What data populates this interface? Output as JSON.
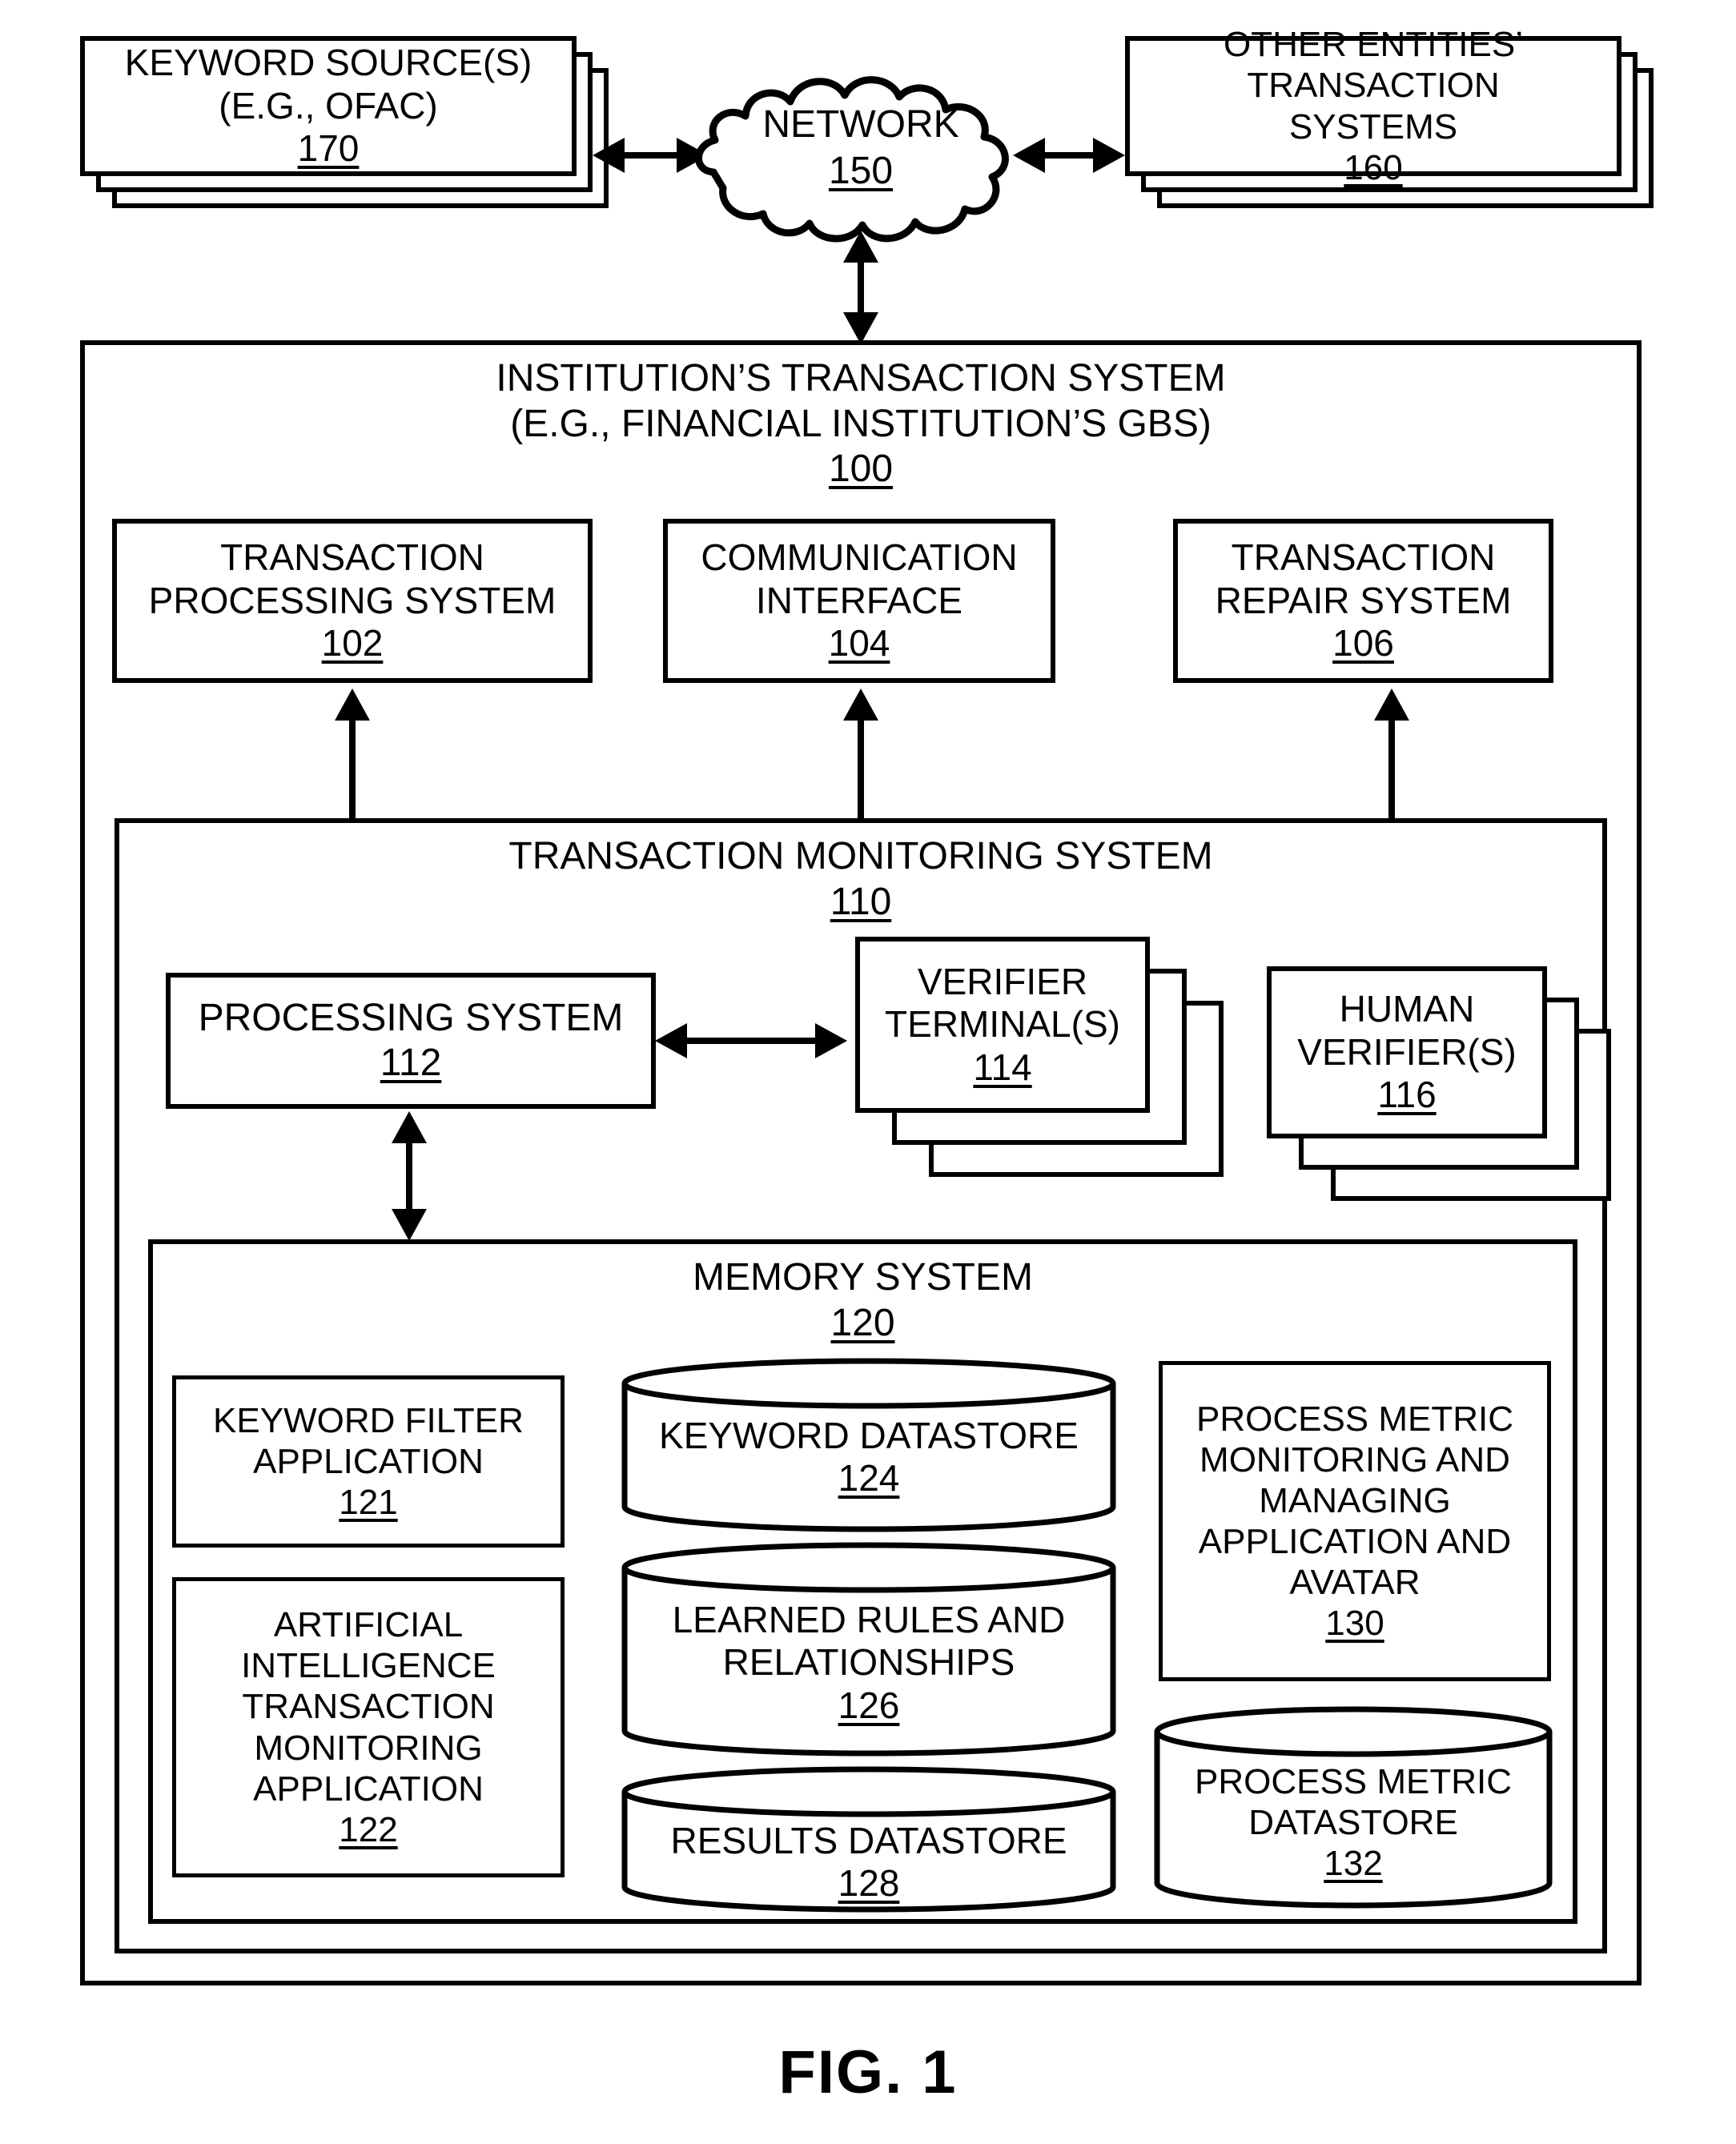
{
  "figure": {
    "caption": "FIG. 1"
  },
  "top_row": {
    "keyword_sources": {
      "line1": "KEYWORD SOURCE(S)",
      "line2": "(E.G., OFAC)",
      "ref": "170"
    },
    "network": {
      "label": "NETWORK",
      "ref": "150"
    },
    "other_entities": {
      "line1": "OTHER ENTITIES’",
      "line2": "TRANSACTION",
      "line3": "SYSTEMS",
      "ref": "160"
    }
  },
  "institution_system": {
    "title_line1": "INSTITUTION’S TRANSACTION SYSTEM",
    "title_line2": "(E.G., FINANCIAL INSTITUTION’S GBS)",
    "ref": "100",
    "components": [
      {
        "line1": "TRANSACTION",
        "line2": "PROCESSING SYSTEM",
        "ref": "102"
      },
      {
        "line1": "COMMUNICATION",
        "line2": "INTERFACE",
        "ref": "104"
      },
      {
        "line1": "TRANSACTION",
        "line2": "REPAIR SYSTEM",
        "ref": "106"
      }
    ]
  },
  "monitoring_system": {
    "title": "TRANSACTION MONITORING SYSTEM",
    "ref": "110",
    "processing_system": {
      "label": "PROCESSING SYSTEM",
      "ref": "112"
    },
    "verifier_terminals": {
      "line1": "VERIFIER",
      "line2": "TERMINAL(S)",
      "ref": "114"
    },
    "human_verifiers": {
      "line1": "HUMAN",
      "line2": "VERIFIER(S)",
      "ref": "116"
    }
  },
  "memory_system": {
    "title": "MEMORY SYSTEM",
    "ref": "120",
    "keyword_filter_application": {
      "line1": "KEYWORD FILTER",
      "line2": "APPLICATION",
      "ref": "121"
    },
    "ai_transaction_monitoring_application": {
      "line1": "ARTIFICIAL",
      "line2": "INTELLIGENCE",
      "line3": "TRANSACTION",
      "line4": "MONITORING",
      "line5": "APPLICATION",
      "ref": "122"
    },
    "keyword_datastore": {
      "line1": "KEYWORD DATASTORE",
      "ref": "124"
    },
    "learned_rules_datastore": {
      "line1": "LEARNED RULES AND",
      "line2": "RELATIONSHIPS",
      "ref": "126"
    },
    "results_datastore": {
      "line1": "RESULTS DATASTORE",
      "ref": "128"
    },
    "process_metric_application": {
      "line1": "PROCESS METRIC",
      "line2": "MONITORING AND",
      "line3": "MANAGING",
      "line4": "APPLICATION AND",
      "line5": "AVATAR",
      "ref": "130"
    },
    "process_metric_datastore": {
      "line1": "PROCESS METRIC",
      "line2": "DATASTORE",
      "ref": "132"
    }
  },
  "colors": {
    "stroke": "#000000",
    "background": "#ffffff"
  }
}
